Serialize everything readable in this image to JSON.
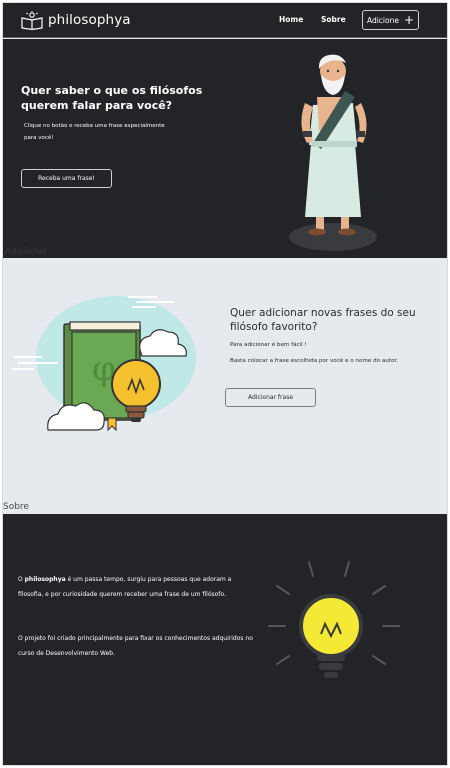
{
  "header": {
    "brand": "philosophya",
    "nav": {
      "home": "Home",
      "sobre": "Sobre",
      "add": "Adicione"
    },
    "icons": {
      "logo": "book-philosopher-icon",
      "add": "plus-icon"
    }
  },
  "hero": {
    "title": "Quer saber o que os filósofos querem falar para você?",
    "text": "Clique no botão e receba uma frase especialmente para você!",
    "button": "Receba uma frase!",
    "anchor": "Adicionar"
  },
  "add_section": {
    "title": "Quer adicionar novas frases do seu filósofo favorito?",
    "line1": "Para adicionar é bem fácil !",
    "line2": "Basta colocar a frase escolhida por você e o nome do autor.",
    "button": "Adicionar frase",
    "anchor": "Sobre"
  },
  "about": {
    "p1_prefix": "O ",
    "p1_brand": "philosophya",
    "p1_rest": " é um passa tempo, surgiu para pessoas que adoram a filosofia, e por curiosidade querem receber uma frase de um filósofo.",
    "p2": "O projeto foi criado principalmente para fixar os conhecimentos adquiridos no curso de Desenvolvimento Web."
  },
  "colors": {
    "dark_bg": "#232427",
    "light_bg": "#e6e9ed",
    "book_green": "#5f9e4a",
    "bulb_yellow": "#f5c12e",
    "bulb_bright": "#f4ea35",
    "cloud_mint": "#bfe8e6"
  }
}
